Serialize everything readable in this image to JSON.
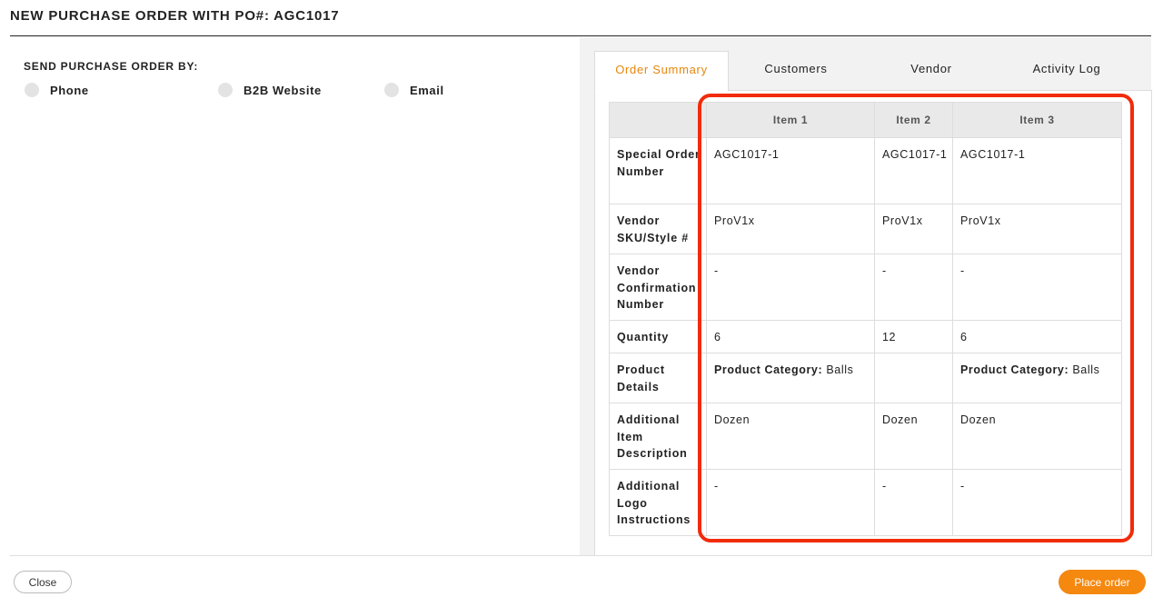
{
  "modal": {
    "title": "NEW PURCHASE ORDER WITH PO#: AGC1017"
  },
  "send_by": {
    "label": "SEND PURCHASE ORDER BY:",
    "options": [
      {
        "label": "Phone"
      },
      {
        "label": "B2B Website"
      },
      {
        "label": "Email"
      }
    ]
  },
  "tabs": [
    {
      "label": "Order Summary",
      "active": true
    },
    {
      "label": "Customers",
      "active": false
    },
    {
      "label": "Vendor",
      "active": false
    },
    {
      "label": "Activity Log",
      "active": false
    }
  ],
  "table": {
    "columns": [
      "Item 1",
      "Item 2",
      "Item 3"
    ],
    "rows": [
      {
        "label": "Special Order Number",
        "cells": [
          "AGC1017-1",
          "AGC1017-1",
          "AGC1017-1"
        ]
      },
      {
        "label": "Vendor SKU/Style #",
        "cells": [
          "ProV1x",
          "ProV1x",
          "ProV1x"
        ]
      },
      {
        "label": "Vendor Confirmation Number",
        "cells": [
          "-",
          "-",
          "-"
        ]
      },
      {
        "label": "Quantity",
        "cells": [
          "6",
          "12",
          "6"
        ]
      },
      {
        "label": "Product Details",
        "cells": [
          {
            "key": "Product Category:",
            "value": "Balls"
          },
          {
            "key": "",
            "value": ""
          },
          {
            "key": "Product Category:",
            "value": "Balls"
          }
        ]
      },
      {
        "label": "Additional Item Description",
        "cells": [
          "Dozen",
          "Dozen",
          "Dozen"
        ]
      },
      {
        "label": "Additional Logo Instructions",
        "cells": [
          "-",
          "-",
          "-"
        ]
      }
    ]
  },
  "footer": {
    "close_label": "Close",
    "place_order_label": "Place order"
  },
  "colors": {
    "accent": "#f5880f",
    "active_tab_text": "#e8860c",
    "highlight": "#f22b0a"
  }
}
